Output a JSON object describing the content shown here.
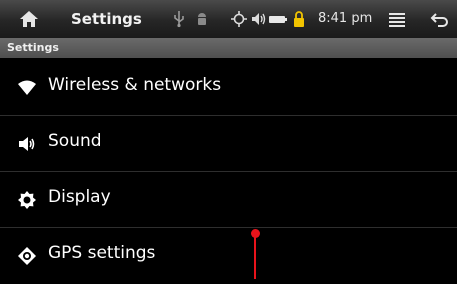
{
  "status_bar": {
    "title": "Settings",
    "time": "8:41 pm",
    "icons": [
      "home-icon",
      "usb-icon",
      "android-debug-icon",
      "gps-icon",
      "volume-icon",
      "battery-icon",
      "lock-icon",
      "menu-icon",
      "back-icon"
    ],
    "battery_color": "#f2c400"
  },
  "subheader": {
    "label": "Settings"
  },
  "items": [
    {
      "label": "Wireless & networks",
      "icon": "wifi-icon"
    },
    {
      "label": "Sound",
      "icon": "speaker-icon"
    },
    {
      "label": "Display",
      "icon": "brightness-icon"
    },
    {
      "label": "GPS settings",
      "icon": "gps-target-icon"
    }
  ],
  "colors": {
    "accent": "#e8131b"
  }
}
